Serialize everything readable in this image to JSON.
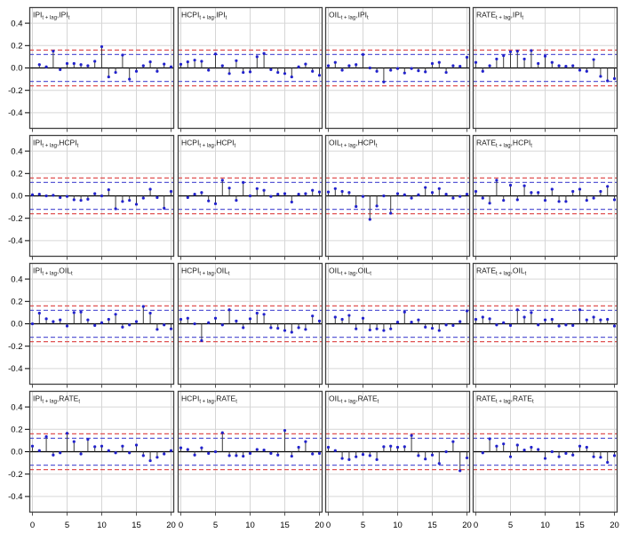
{
  "figure": {
    "background": "#ffffff",
    "colors": {
      "panel_border": "#404040",
      "grid_line": "#d6d6d6",
      "zero_line": "#000000",
      "stem": "#3c3c3c",
      "point": "#2222cc",
      "conf_outer": "#e05252",
      "conf_inner": "#5b5bd6",
      "axis_text": "#000000"
    }
  },
  "chart_data": {
    "type": "bar",
    "subtype": "stem (cross-correlation function matrix, 4x4 panels)",
    "title": "",
    "xlabel": "",
    "ylabel": "",
    "variables": [
      "IPI",
      "HCPI",
      "OIL",
      "RATE"
    ],
    "x_axis": {
      "ticks": [
        "0",
        "5",
        "10",
        "15",
        "20"
      ],
      "tick_values": [
        0,
        5,
        10,
        15,
        20
      ],
      "range": [
        0,
        20
      ]
    },
    "y_axis": {
      "ticks": [
        "0.4",
        "0.2",
        "0.0",
        "-0.2",
        "-0.4"
      ],
      "tick_values": [
        0.4,
        0.2,
        0.0,
        -0.2,
        -0.4
      ],
      "range": [
        -0.54,
        0.54
      ]
    },
    "grid": "on",
    "legend": "none",
    "confidence_bands": {
      "outer": {
        "value": 0.16,
        "style": "dashed",
        "color": "#e05252"
      },
      "inner": {
        "value": 0.12,
        "style": "dashed",
        "color": "#5b5bd6"
      }
    },
    "title_subscript_lag": "t + lag",
    "title_subscript_t": "t",
    "title_separator": ",",
    "panels": [
      {
        "first": "IPI",
        "second": "IPI",
        "label": "IPI[t+lag],IPI[t]",
        "start_lag": 1,
        "values": [
          0.03,
          0.01,
          0.15,
          -0.015,
          0.04,
          0.04,
          0.03,
          0.02,
          0.06,
          0.19,
          -0.08,
          -0.04,
          0.115,
          -0.1,
          -0.03,
          0.02,
          0.055,
          -0.03,
          0.035,
          0.01
        ]
      },
      {
        "first": "HCPI",
        "second": "IPI",
        "label": "HCPI[t+lag],IPI[t]",
        "start_lag": 0,
        "values": [
          0.033,
          0.055,
          0.07,
          0.06,
          -0.02,
          0.125,
          0.02,
          -0.05,
          0.065,
          -0.04,
          -0.035,
          0.1,
          0.13,
          -0.015,
          -0.04,
          -0.05,
          -0.08,
          0.01,
          0.035,
          -0.03,
          -0.065
        ]
      },
      {
        "first": "OIL",
        "second": "IPI",
        "label": "OIL[t+lag],IPI[t]",
        "start_lag": 0,
        "values": [
          0.02,
          0.05,
          -0.02,
          0.02,
          0.03,
          0.12,
          0.0,
          -0.03,
          -0.125,
          -0.02,
          -0.005,
          -0.045,
          -0.005,
          -0.025,
          -0.035,
          0.04,
          0.05,
          -0.04,
          0.02,
          0.015,
          0.095
        ]
      },
      {
        "first": "RATE",
        "second": "IPI",
        "label": "RATE[t+lag],IPI[t]",
        "start_lag": 0,
        "values": [
          0.05,
          -0.03,
          0.02,
          0.08,
          0.11,
          0.145,
          0.15,
          0.08,
          0.155,
          0.04,
          0.105,
          0.05,
          0.02,
          0.015,
          0.02,
          -0.02,
          -0.03,
          0.075,
          -0.075,
          -0.115,
          -0.095
        ]
      },
      {
        "first": "IPI",
        "second": "HCPI",
        "label": "IPI[t+lag],HCPI[t]",
        "start_lag": 0,
        "values": [
          0.01,
          0.015,
          0.0,
          0.005,
          -0.015,
          -0.005,
          -0.035,
          -0.04,
          -0.03,
          0.02,
          0.0,
          0.055,
          -0.115,
          -0.05,
          -0.04,
          -0.075,
          -0.02,
          0.06,
          -0.015,
          -0.11,
          0.04
        ]
      },
      {
        "first": "HCPI",
        "second": "HCPI",
        "label": "HCPI[t+lag],HCPI[t]",
        "start_lag": 1,
        "values": [
          -0.015,
          0.015,
          0.03,
          -0.045,
          -0.07,
          0.14,
          0.07,
          -0.04,
          0.12,
          0.0,
          0.065,
          0.05,
          -0.005,
          0.015,
          0.02,
          -0.055,
          0.015,
          0.02,
          0.05,
          0.035
        ]
      },
      {
        "first": "OIL",
        "second": "HCPI",
        "label": "OIL[t+lag],HCPI[t]",
        "start_lag": 0,
        "values": [
          0.035,
          0.065,
          0.04,
          0.03,
          -0.095,
          -0.005,
          -0.21,
          -0.09,
          0.0,
          -0.155,
          0.02,
          0.01,
          -0.02,
          0.01,
          0.075,
          0.03,
          0.065,
          0.015,
          -0.02,
          -0.005,
          0.015
        ]
      },
      {
        "first": "RATE",
        "second": "HCPI",
        "label": "RATE[t+lag],HCPI[t]",
        "start_lag": 0,
        "values": [
          0.04,
          -0.02,
          -0.065,
          0.14,
          -0.04,
          0.095,
          -0.035,
          0.09,
          0.03,
          0.03,
          -0.04,
          0.06,
          -0.05,
          -0.05,
          0.04,
          0.06,
          -0.04,
          -0.02,
          0.04,
          0.085,
          -0.035
        ]
      },
      {
        "first": "IPI",
        "second": "OIL",
        "label": "IPI[t+lag],OIL[t]",
        "start_lag": 0,
        "values": [
          0.0,
          0.095,
          0.045,
          0.02,
          0.035,
          -0.02,
          0.1,
          0.105,
          0.035,
          -0.015,
          0.01,
          0.04,
          0.085,
          -0.03,
          -0.01,
          0.02,
          0.155,
          0.095,
          -0.05,
          -0.01,
          -0.045
        ]
      },
      {
        "first": "HCPI",
        "second": "OIL",
        "label": "HCPI[t+lag],OIL[t]",
        "start_lag": 0,
        "values": [
          0.04,
          0.05,
          0.0,
          -0.15,
          0.01,
          0.05,
          -0.01,
          0.125,
          0.025,
          -0.035,
          0.045,
          0.095,
          0.085,
          -0.035,
          -0.04,
          -0.06,
          -0.075,
          -0.035,
          -0.05,
          0.07,
          0.025
        ]
      },
      {
        "first": "OIL",
        "second": "OIL",
        "label": "OIL[t+lag],OIL[t]",
        "start_lag": 1,
        "values": [
          0.06,
          0.04,
          0.075,
          -0.045,
          0.05,
          -0.055,
          -0.045,
          -0.06,
          -0.045,
          0.015,
          0.105,
          0.015,
          0.035,
          -0.03,
          -0.04,
          -0.06,
          -0.01,
          -0.015,
          0.02,
          0.115
        ]
      },
      {
        "first": "RATE",
        "second": "OIL",
        "label": "RATE[t+lag],OIL[t]",
        "start_lag": 0,
        "values": [
          0.04,
          0.06,
          0.045,
          -0.01,
          0.01,
          -0.015,
          0.125,
          0.06,
          0.1,
          -0.01,
          0.035,
          0.04,
          -0.02,
          -0.01,
          -0.015,
          0.125,
          0.035,
          0.06,
          0.035,
          0.04,
          -0.02
        ]
      },
      {
        "first": "IPI",
        "second": "RATE",
        "label": "IPI[t+lag],RATE[t]",
        "start_lag": 0,
        "values": [
          0.05,
          0.01,
          0.135,
          -0.03,
          -0.01,
          0.165,
          0.09,
          -0.02,
          0.11,
          0.045,
          0.05,
          0.01,
          -0.01,
          0.05,
          -0.01,
          0.06,
          -0.035,
          -0.08,
          -0.05,
          -0.02,
          0.01
        ]
      },
      {
        "first": "HCPI",
        "second": "RATE",
        "label": "HCPI[t+lag],RATE[t]",
        "start_lag": 0,
        "values": [
          0.035,
          0.02,
          -0.03,
          0.035,
          -0.015,
          0.0,
          0.17,
          -0.035,
          -0.035,
          -0.04,
          -0.015,
          0.02,
          0.015,
          -0.015,
          -0.03,
          0.19,
          -0.04,
          0.04,
          0.09,
          -0.02,
          -0.015
        ]
      },
      {
        "first": "OIL",
        "second": "RATE",
        "label": "OIL[t+lag],RATE[t]",
        "start_lag": 0,
        "values": [
          0.04,
          0.01,
          -0.06,
          -0.07,
          -0.045,
          -0.025,
          -0.035,
          -0.07,
          0.045,
          0.05,
          0.04,
          0.045,
          0.145,
          -0.035,
          -0.065,
          -0.03,
          -0.105,
          0.0,
          0.09,
          -0.17,
          -0.055
        ]
      },
      {
        "first": "RATE",
        "second": "RATE",
        "label": "RATE[t+lag],RATE[t]",
        "start_lag": 1,
        "values": [
          -0.01,
          0.115,
          0.05,
          0.07,
          -0.045,
          0.06,
          0.015,
          0.04,
          0.02,
          -0.06,
          0.0,
          -0.045,
          -0.015,
          -0.03,
          0.05,
          0.04,
          -0.045,
          -0.05,
          -0.095,
          -0.035
        ]
      }
    ]
  }
}
